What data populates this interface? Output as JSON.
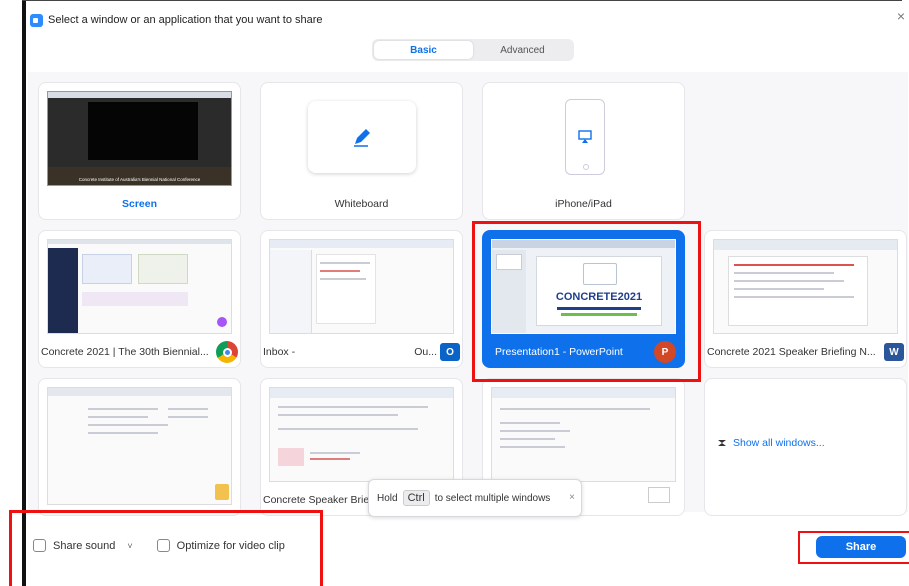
{
  "dialog": {
    "title": "Select a window or an application that you want to share",
    "close_glyph": "×"
  },
  "tabs": [
    {
      "label": "Basic",
      "active": true
    },
    {
      "label": "Advanced",
      "active": false
    }
  ],
  "tiles": {
    "screen": {
      "label": "Screen",
      "thumb_caption": "Concrete Institute of Australia's Biennial National Conference"
    },
    "whiteboard": {
      "label": "Whiteboard"
    },
    "iphone": {
      "label": "iPhone/iPad"
    },
    "chrome": {
      "label": "Concrete 2021 | The 30th Biennial..."
    },
    "outlook_inbox": {
      "label_left": "Inbox -",
      "label_right": "Ou..."
    },
    "powerpoint": {
      "label": "Presentation1 - PowerPoint",
      "thumb_logo": "CONCRETE2021"
    },
    "word": {
      "label": "Concrete 2021 Speaker Briefing N..."
    },
    "explorer": {
      "label": ""
    },
    "outlook_speaker": {
      "label": "Concrete Speaker Brie"
    },
    "outlook_mail": {
      "label": ""
    },
    "show_all": {
      "label": "Show all windows..."
    }
  },
  "tooltip": {
    "prefix": "Hold",
    "key": "Ctrl",
    "suffix": "to select multiple windows",
    "close_glyph": "×"
  },
  "footer": {
    "share_sound": "Share sound",
    "share_sound_caret": "˅",
    "optimize": "Optimize for video clip",
    "share_button": "Share"
  },
  "colors": {
    "accent": "#0e71eb",
    "highlight_red": "#e11111"
  },
  "icons": {
    "zoom": "zoom-logo-icon",
    "chrome": "chrome-icon",
    "outlook": "outlook-icon",
    "powerpoint": "powerpoint-icon",
    "word": "word-icon",
    "pen": "pen-icon",
    "airplay": "airplay-icon",
    "show_all": "show-all-windows-icon"
  }
}
